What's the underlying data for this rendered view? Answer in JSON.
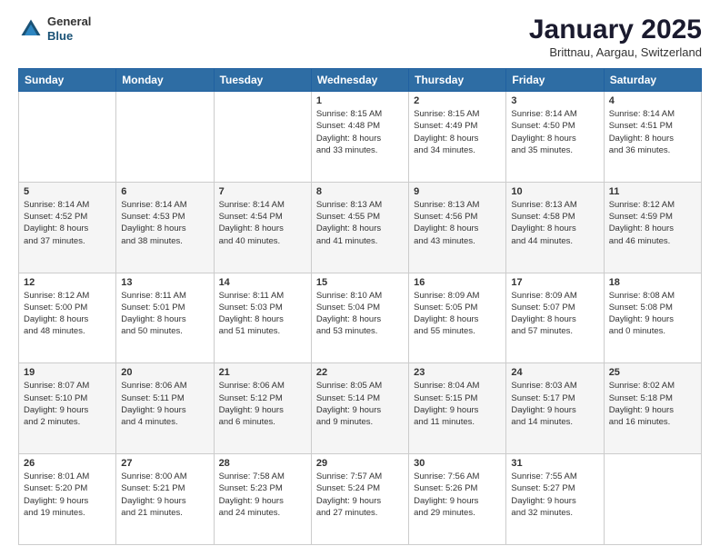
{
  "header": {
    "logo_general": "General",
    "logo_blue": "Blue",
    "month_title": "January 2025",
    "location": "Brittnau, Aargau, Switzerland"
  },
  "calendar": {
    "days_of_week": [
      "Sunday",
      "Monday",
      "Tuesday",
      "Wednesday",
      "Thursday",
      "Friday",
      "Saturday"
    ],
    "weeks": [
      [
        {
          "day": "",
          "info": ""
        },
        {
          "day": "",
          "info": ""
        },
        {
          "day": "",
          "info": ""
        },
        {
          "day": "1",
          "info": "Sunrise: 8:15 AM\nSunset: 4:48 PM\nDaylight: 8 hours\nand 33 minutes."
        },
        {
          "day": "2",
          "info": "Sunrise: 8:15 AM\nSunset: 4:49 PM\nDaylight: 8 hours\nand 34 minutes."
        },
        {
          "day": "3",
          "info": "Sunrise: 8:14 AM\nSunset: 4:50 PM\nDaylight: 8 hours\nand 35 minutes."
        },
        {
          "day": "4",
          "info": "Sunrise: 8:14 AM\nSunset: 4:51 PM\nDaylight: 8 hours\nand 36 minutes."
        }
      ],
      [
        {
          "day": "5",
          "info": "Sunrise: 8:14 AM\nSunset: 4:52 PM\nDaylight: 8 hours\nand 37 minutes."
        },
        {
          "day": "6",
          "info": "Sunrise: 8:14 AM\nSunset: 4:53 PM\nDaylight: 8 hours\nand 38 minutes."
        },
        {
          "day": "7",
          "info": "Sunrise: 8:14 AM\nSunset: 4:54 PM\nDaylight: 8 hours\nand 40 minutes."
        },
        {
          "day": "8",
          "info": "Sunrise: 8:13 AM\nSunset: 4:55 PM\nDaylight: 8 hours\nand 41 minutes."
        },
        {
          "day": "9",
          "info": "Sunrise: 8:13 AM\nSunset: 4:56 PM\nDaylight: 8 hours\nand 43 minutes."
        },
        {
          "day": "10",
          "info": "Sunrise: 8:13 AM\nSunset: 4:58 PM\nDaylight: 8 hours\nand 44 minutes."
        },
        {
          "day": "11",
          "info": "Sunrise: 8:12 AM\nSunset: 4:59 PM\nDaylight: 8 hours\nand 46 minutes."
        }
      ],
      [
        {
          "day": "12",
          "info": "Sunrise: 8:12 AM\nSunset: 5:00 PM\nDaylight: 8 hours\nand 48 minutes."
        },
        {
          "day": "13",
          "info": "Sunrise: 8:11 AM\nSunset: 5:01 PM\nDaylight: 8 hours\nand 50 minutes."
        },
        {
          "day": "14",
          "info": "Sunrise: 8:11 AM\nSunset: 5:03 PM\nDaylight: 8 hours\nand 51 minutes."
        },
        {
          "day": "15",
          "info": "Sunrise: 8:10 AM\nSunset: 5:04 PM\nDaylight: 8 hours\nand 53 minutes."
        },
        {
          "day": "16",
          "info": "Sunrise: 8:09 AM\nSunset: 5:05 PM\nDaylight: 8 hours\nand 55 minutes."
        },
        {
          "day": "17",
          "info": "Sunrise: 8:09 AM\nSunset: 5:07 PM\nDaylight: 8 hours\nand 57 minutes."
        },
        {
          "day": "18",
          "info": "Sunrise: 8:08 AM\nSunset: 5:08 PM\nDaylight: 9 hours\nand 0 minutes."
        }
      ],
      [
        {
          "day": "19",
          "info": "Sunrise: 8:07 AM\nSunset: 5:10 PM\nDaylight: 9 hours\nand 2 minutes."
        },
        {
          "day": "20",
          "info": "Sunrise: 8:06 AM\nSunset: 5:11 PM\nDaylight: 9 hours\nand 4 minutes."
        },
        {
          "day": "21",
          "info": "Sunrise: 8:06 AM\nSunset: 5:12 PM\nDaylight: 9 hours\nand 6 minutes."
        },
        {
          "day": "22",
          "info": "Sunrise: 8:05 AM\nSunset: 5:14 PM\nDaylight: 9 hours\nand 9 minutes."
        },
        {
          "day": "23",
          "info": "Sunrise: 8:04 AM\nSunset: 5:15 PM\nDaylight: 9 hours\nand 11 minutes."
        },
        {
          "day": "24",
          "info": "Sunrise: 8:03 AM\nSunset: 5:17 PM\nDaylight: 9 hours\nand 14 minutes."
        },
        {
          "day": "25",
          "info": "Sunrise: 8:02 AM\nSunset: 5:18 PM\nDaylight: 9 hours\nand 16 minutes."
        }
      ],
      [
        {
          "day": "26",
          "info": "Sunrise: 8:01 AM\nSunset: 5:20 PM\nDaylight: 9 hours\nand 19 minutes."
        },
        {
          "day": "27",
          "info": "Sunrise: 8:00 AM\nSunset: 5:21 PM\nDaylight: 9 hours\nand 21 minutes."
        },
        {
          "day": "28",
          "info": "Sunrise: 7:58 AM\nSunset: 5:23 PM\nDaylight: 9 hours\nand 24 minutes."
        },
        {
          "day": "29",
          "info": "Sunrise: 7:57 AM\nSunset: 5:24 PM\nDaylight: 9 hours\nand 27 minutes."
        },
        {
          "day": "30",
          "info": "Sunrise: 7:56 AM\nSunset: 5:26 PM\nDaylight: 9 hours\nand 29 minutes."
        },
        {
          "day": "31",
          "info": "Sunrise: 7:55 AM\nSunset: 5:27 PM\nDaylight: 9 hours\nand 32 minutes."
        },
        {
          "day": "",
          "info": ""
        }
      ]
    ]
  }
}
